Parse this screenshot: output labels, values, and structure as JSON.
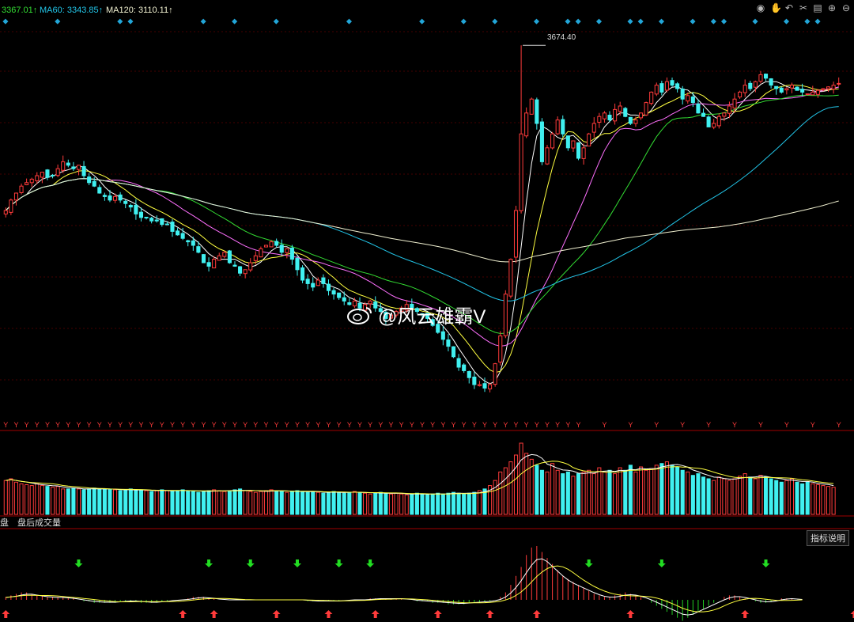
{
  "header": {
    "ma_labels": [
      {
        "text": "3367.01↑",
        "color": "#33dd33"
      },
      {
        "text": "MA60: 3343.85↑",
        "color": "#22c5e8"
      },
      {
        "text": "MA120: 3110.11↑",
        "color": "#f0f0d0"
      }
    ],
    "toolbar_icons": [
      "eye-icon",
      "hand-icon",
      "undo-icon",
      "scissors-icon",
      "print-icon",
      "zoom-in-icon",
      "zoom-out-icon"
    ]
  },
  "peak_label": "3674.40",
  "watermark": "@风云雄霸V",
  "volume_tabs": [
    "盘",
    "盘后成交量"
  ],
  "indicator_button": "指标说明",
  "colors": {
    "up": "#ff3b3b",
    "down": "#40f0f0",
    "ma5": "#ffffff",
    "ma10": "#ffff40",
    "ma20": "#ff70ff",
    "ma30": "#33dd33",
    "ma60": "#22c5e8",
    "ma120": "#f0f0d0",
    "grid": "#8b0000",
    "diamond": "#22a6d8",
    "signal_y": "#ff3b3b"
  },
  "chart_data": {
    "type": "candlestick",
    "title": "",
    "closes": [
      3200,
      3230,
      3250,
      3270,
      3280,
      3290,
      3300,
      3310,
      3295,
      3300,
      3320,
      3340,
      3330,
      3320,
      3330,
      3300,
      3280,
      3270,
      3250,
      3240,
      3230,
      3240,
      3230,
      3220,
      3210,
      3190,
      3180,
      3180,
      3170,
      3170,
      3160,
      3160,
      3140,
      3130,
      3120,
      3110,
      3100,
      3080,
      3050,
      3040,
      3060,
      3070,
      3080,
      3050,
      3040,
      3020,
      3030,
      3050,
      3070,
      3090,
      3100,
      3110,
      3100,
      3080,
      3090,
      3060,
      3030,
      3000,
      2990,
      2980,
      3000,
      2990,
      2970,
      2960,
      2950,
      2940,
      2930,
      2940,
      2920,
      2930,
      2940,
      2920,
      2910,
      2890,
      2900,
      2910,
      2920,
      2930,
      2920,
      2910,
      2900,
      2890,
      2870,
      2850,
      2830,
      2810,
      2780,
      2750,
      2740,
      2720,
      2700,
      2700,
      2690,
      2700,
      2760,
      2840,
      2960,
      3060,
      3200,
      3420,
      3480,
      3520,
      3450,
      3340,
      3380,
      3420,
      3460,
      3420,
      3380,
      3400,
      3350,
      3380,
      3420,
      3450,
      3470,
      3480,
      3460,
      3490,
      3500,
      3470,
      3450,
      3460,
      3480,
      3510,
      3540,
      3560,
      3540,
      3570,
      3560,
      3550,
      3520,
      3530,
      3510,
      3480,
      3470,
      3440,
      3450,
      3470,
      3480,
      3500,
      3520,
      3540,
      3560,
      3550,
      3570,
      3590,
      3580,
      3560,
      3550,
      3540,
      3550,
      3560,
      3545,
      3540,
      3535,
      3540,
      3545,
      3550,
      3555,
      3560,
      3565
    ],
    "ma60_last": 3343.85,
    "ma120_last": 3110.11,
    "peak": 3674.4,
    "ylim": [
      2600,
      3750
    ],
    "volume": [
      40,
      42,
      38,
      36,
      35,
      34,
      36,
      34,
      33,
      32,
      33,
      30,
      30,
      31,
      30,
      29,
      30,
      31,
      30,
      30,
      29,
      29,
      28,
      29,
      30,
      28,
      29,
      28,
      27,
      28,
      29,
      28,
      27,
      28,
      29,
      28,
      27,
      26,
      27,
      28,
      29,
      28,
      27,
      28,
      29,
      30,
      28,
      27,
      26,
      27,
      28,
      29,
      28,
      27,
      26,
      27,
      28,
      27,
      26,
      27,
      26,
      25,
      26,
      27,
      26,
      25,
      26,
      27,
      26,
      25,
      24,
      25,
      26,
      25,
      24,
      25,
      24,
      23,
      24,
      25,
      24,
      23,
      24,
      25,
      24,
      25,
      26,
      25,
      24,
      25,
      26,
      28,
      30,
      34,
      40,
      50,
      55,
      62,
      70,
      84,
      72,
      65,
      58,
      52,
      50,
      60,
      52,
      48,
      50,
      45,
      48,
      50,
      52,
      48,
      55,
      50,
      52,
      48,
      55,
      52,
      58,
      50,
      56,
      52,
      54,
      58,
      60,
      62,
      58,
      56,
      52,
      50,
      46,
      48,
      44,
      42,
      40,
      44,
      42,
      40,
      42,
      45,
      48,
      44,
      42,
      46,
      44,
      42,
      40,
      38,
      40,
      42,
      38,
      36,
      38,
      36,
      35,
      34,
      33,
      32
    ],
    "macd_hist": [
      2,
      3,
      4,
      5,
      5,
      4,
      3,
      3,
      2,
      2,
      2,
      2,
      1,
      1,
      0,
      -1,
      -1,
      -2,
      -2,
      -2,
      -2,
      -2,
      -1,
      -1,
      -1,
      -1,
      -2,
      -2,
      -2,
      -2,
      -1,
      -1,
      0,
      0,
      0,
      1,
      2,
      2,
      2,
      1,
      1,
      0,
      0,
      0,
      0,
      0,
      0,
      0,
      0,
      0,
      0,
      0,
      0,
      0,
      0,
      0,
      0,
      0,
      -1,
      -1,
      -1,
      -1,
      -1,
      -1,
      -1,
      0,
      0,
      0,
      0,
      0,
      1,
      1,
      1,
      1,
      1,
      1,
      1,
      0,
      0,
      -1,
      -1,
      -1,
      -2,
      -2,
      -2,
      -3,
      -3,
      -3,
      -3,
      -2,
      -2,
      -2,
      -1,
      -1,
      0,
      2,
      5,
      10,
      16,
      22,
      30,
      35,
      36,
      32,
      28,
      24,
      20,
      16,
      14,
      12,
      10,
      8,
      6,
      4,
      3,
      2,
      2,
      3,
      4,
      5,
      4,
      3,
      2,
      0,
      -2,
      -4,
      -6,
      -8,
      -10,
      -12,
      -14,
      -12,
      -10,
      -8,
      -6,
      -4,
      -2,
      0,
      2,
      3,
      3,
      2,
      1,
      0,
      -1,
      -2,
      -2,
      -1,
      0,
      1,
      1,
      1,
      0,
      0
    ],
    "buy_signals": [
      0,
      34,
      40,
      52,
      62,
      71,
      83,
      93,
      102,
      120,
      142,
      163
    ],
    "sell_signals": [
      14,
      39,
      47,
      56,
      64,
      70,
      112,
      126,
      146
    ]
  }
}
